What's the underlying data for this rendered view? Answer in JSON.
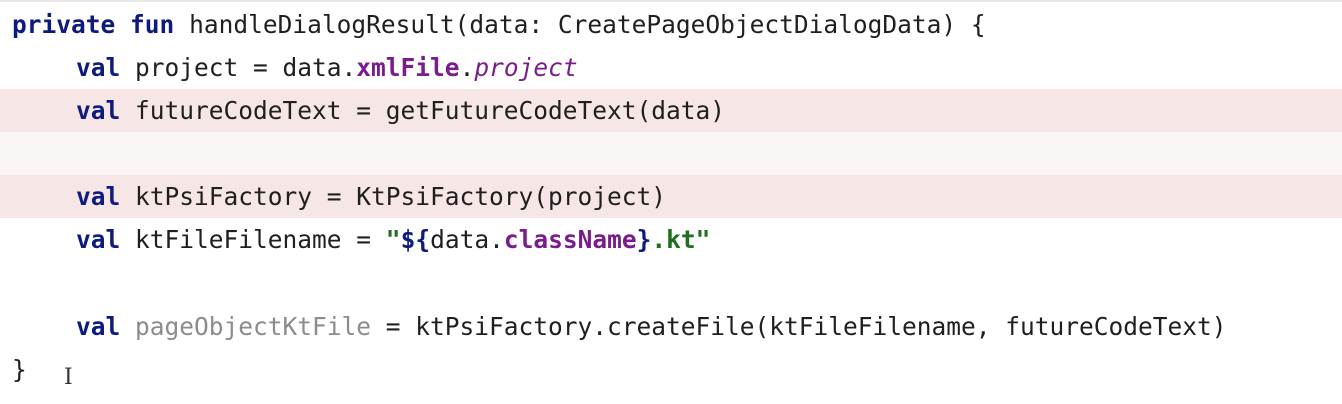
{
  "code": {
    "l1": {
      "kw1": "private",
      "kw2": "fun",
      "sig": "handleDialogResult(data: CreatePageObjectDialogData) {"
    },
    "l2": {
      "kw": "val",
      "a": "project = data.",
      "prop": "xmlFile",
      "dot": ".",
      "italic": "project"
    },
    "l3": {
      "kw": "val",
      "text": "futureCodeText = getFutureCodeText(data)"
    },
    "l5": {
      "kw": "val",
      "text": "ktPsiFactory = KtPsiFactory(project)"
    },
    "l6": {
      "kw": "val",
      "a": "ktFileFilename = ",
      "q1": "\"",
      "b1": "${",
      "ref": "data.",
      "prop": "className",
      "b2": "}",
      "tail": ".kt\""
    },
    "l8": {
      "kw": "val",
      "unused": "pageObjectKtFile",
      "text": " = ktPsiFactory.createFile(ktFileFilename, futureCodeText)"
    },
    "l9": {
      "close": "}"
    }
  },
  "cursor_glyph": "I",
  "colors": {
    "keyword": "#0d1b7c",
    "property": "#7a1d8c",
    "string": "#1f6f1f",
    "unused": "#8c8c8c",
    "highlight": "#f7e6e6"
  }
}
